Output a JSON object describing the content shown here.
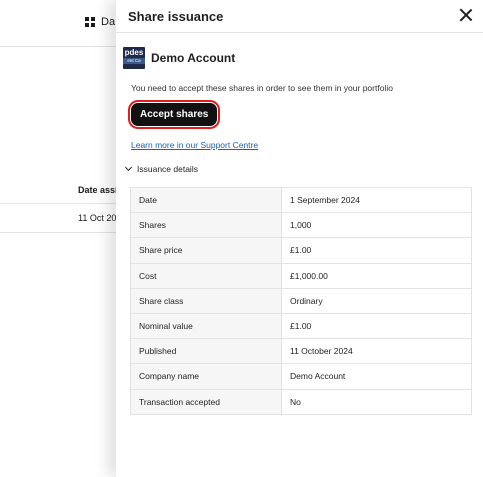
{
  "background": {
    "nav_item": "Da",
    "column_header": "Date assi",
    "row_value": "11 Oct 20"
  },
  "drawer": {
    "title": "Share issuance",
    "account": {
      "logo_text": "pdes",
      "logo_subtext": "ent Ca",
      "name": "Demo Account"
    },
    "notice": "You need to accept these shares in order to see them in your portfolio",
    "accept_button": "Accept shares",
    "support_link": "Learn more in our Support Centre",
    "details_toggle": "Issuance details",
    "details": [
      {
        "label": "Date",
        "value": "1 September 2024"
      },
      {
        "label": "Shares",
        "value": "1,000"
      },
      {
        "label": "Share price",
        "value": "£1.00"
      },
      {
        "label": "Cost",
        "value": "£1,000.00"
      },
      {
        "label": "Share class",
        "value": "Ordinary"
      },
      {
        "label": "Nominal value",
        "value": "£1.00"
      },
      {
        "label": "Published",
        "value": "11 October 2024"
      },
      {
        "label": "Company name",
        "value": "Demo Account"
      },
      {
        "label": "Transaction accepted",
        "value": "No"
      }
    ]
  },
  "colors": {
    "accent_outline": "#e11d1d",
    "button_bg": "#111111",
    "link": "#1a5fb4"
  }
}
